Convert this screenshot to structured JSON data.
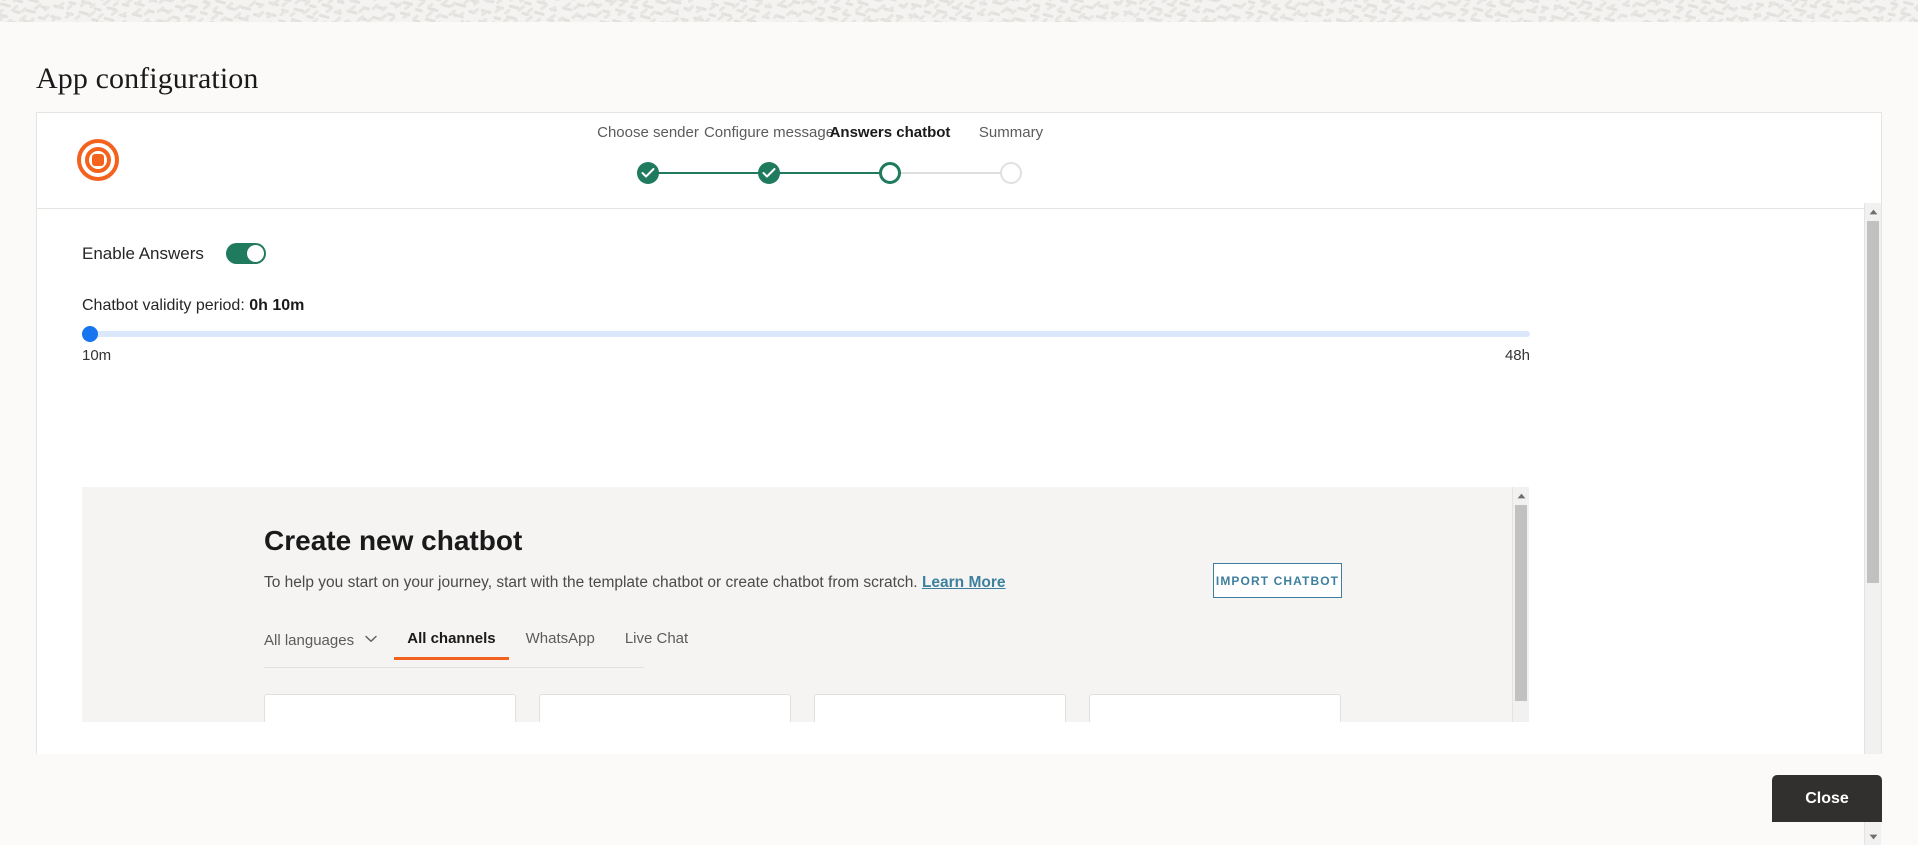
{
  "page": {
    "title": "App configuration"
  },
  "brand": {
    "logo_icon": "target-bullseye-icon",
    "logo_color": "#f4631e"
  },
  "stepper": {
    "steps": [
      {
        "label": "Choose sender",
        "state": "done"
      },
      {
        "label": "Configure message",
        "state": "done"
      },
      {
        "label": "Answers chatbot",
        "state": "current"
      },
      {
        "label": "Summary",
        "state": "upcoming"
      }
    ],
    "done_color": "#1f7a5e",
    "upcoming_color": "#e0e0e0"
  },
  "answers": {
    "enable_label": "Enable Answers",
    "enable_state": "on",
    "toggle_color": "#1f7a5e",
    "validity_prefix": "Chatbot validity period: ",
    "validity_value": "0h 10m",
    "slider": {
      "min_label": "10m",
      "max_label": "48h",
      "value_percent": 0,
      "thumb_color": "#1675ef",
      "track_color": "#dbe8fb"
    }
  },
  "chatbot_panel": {
    "title": "Create new chatbot",
    "description": "To help you start on your journey, start with the template chatbot or create chatbot from scratch. ",
    "learn_more": "Learn More",
    "import_button": "IMPORT CHATBOT",
    "accent_color": "#3d7f9e",
    "filters": {
      "language_dropdown": "All languages",
      "chevron_icon": "chevron-down-icon",
      "tabs": [
        {
          "label": "All channels",
          "active": true
        },
        {
          "label": "WhatsApp",
          "active": false
        },
        {
          "label": "Live Chat",
          "active": false
        }
      ],
      "active_underline_color": "#f26322"
    },
    "template_cards": [
      1,
      2,
      3,
      4
    ]
  },
  "footer": {
    "close_label": "Close"
  },
  "scrollbars": {
    "up_arrow_icon": "caret-up-icon",
    "down_arrow_icon": "caret-down-icon"
  }
}
